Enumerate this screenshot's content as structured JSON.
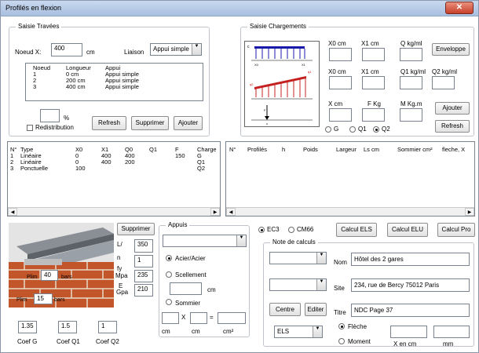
{
  "window": {
    "title": "Profilés en flexion",
    "close_glyph": "✕"
  },
  "travees": {
    "legend": "Saisie Travées",
    "noeud_label": "Noeud X:",
    "noeud_value": "400",
    "unit_cm": "cm",
    "liaison_label": "Liaison",
    "liaison_value": "Appui simple",
    "list_headers": [
      "Noeud",
      "Longueur",
      "Appui"
    ],
    "rows": [
      [
        "1",
        "0 cm",
        "Appui simple"
      ],
      [
        "2",
        "200 cm",
        "Appui simple"
      ],
      [
        "3",
        "400 cm",
        "Appui simple"
      ]
    ],
    "percent_label": "%",
    "redistribution_label": "Redistribution",
    "refresh": "Refresh",
    "supprimer": "Supprimer",
    "ajouter": "Ajouter"
  },
  "chargements": {
    "legend": "Saisie Chargements",
    "r1": [
      "X0 cm",
      "X1 cm",
      "Q kg/ml"
    ],
    "enveloppe": "Enveloppe",
    "r2": [
      "X0 cm",
      "X1 cm",
      "Q1 kg/ml",
      "Q2 kg/ml"
    ],
    "r3": [
      "X cm",
      "F Kg",
      "M Kg.m"
    ],
    "ajouter": "Ajouter",
    "refresh": "Refresh",
    "radios": [
      "G",
      "Q1",
      "Q2"
    ],
    "diagram": {
      "c": "c",
      "x0": "X0",
      "x1": "X1",
      "q1": "q1",
      "q2": "q2",
      "f": "F",
      "x": "x"
    }
  },
  "charges": {
    "headers": [
      "N°",
      "Type",
      "X0",
      "X1",
      "Q0",
      "Q1",
      "F",
      "Charge"
    ],
    "rows": [
      [
        "1",
        "Linéaire",
        "0",
        "400",
        "400",
        "",
        "",
        "G"
      ],
      [
        "2",
        "Linéaire",
        "0",
        "400",
        "200",
        "",
        "",
        "Q1"
      ],
      [
        "3",
        "Ponctuelle",
        "100",
        "",
        "",
        "",
        "150",
        "Q2"
      ]
    ]
  },
  "profiles": {
    "headers": [
      "N°",
      "Profilés",
      "h",
      "Poids",
      "Largeur",
      "Ls cm",
      "Sommier cm²",
      "fleche, X"
    ]
  },
  "bottom_left": {
    "supprimer": "Supprimer",
    "l_label": "L/",
    "l_value": "350",
    "n_label": "n",
    "n_value": "1",
    "fy_label": "fy",
    "mpa_label": "Mpa",
    "fy_value": "235",
    "e_label": "E",
    "gpa_label": "Gpa",
    "e_value": "210",
    "plim1_label": "Plim",
    "plim1_value": "40",
    "plim2_label": "Plim",
    "plim2_value": "15",
    "bars": "bars",
    "coef_g_value": "1.35",
    "coef_q1_value": "1.5",
    "coef_q2_value": "1",
    "coef_g": "Coef G",
    "coef_q1": "Coef Q1",
    "coef_q2": "Coef Q2"
  },
  "appuis": {
    "legend": "Appuis",
    "acier": "Acier/Acier",
    "scellement": "Scellement",
    "cm": "cm",
    "sommier": "Sommier",
    "x": "X",
    "eq": "=",
    "units": [
      "cm",
      "cm",
      "cm²"
    ]
  },
  "calc": {
    "ec3": "EC3",
    "cm66": "CM66",
    "els": "Calcul ELS",
    "elu": "Calcul ELU",
    "pro": "Calcul Pro",
    "note_legend": "Note de calculs",
    "nom_label": "Nom",
    "nom_value": "Hôtel des 2 gares",
    "site_label": "Site",
    "site_value": "234, rue de Bercy 75012 Paris",
    "titre_label": "Titre",
    "titre_value": "NDC Page 37",
    "centre": "Centre",
    "editer": "Editer",
    "els_select": "ELS",
    "fleche": "Flèche",
    "moment": "Moment",
    "x_en_cm": "X en cm",
    "mm": "mm"
  }
}
